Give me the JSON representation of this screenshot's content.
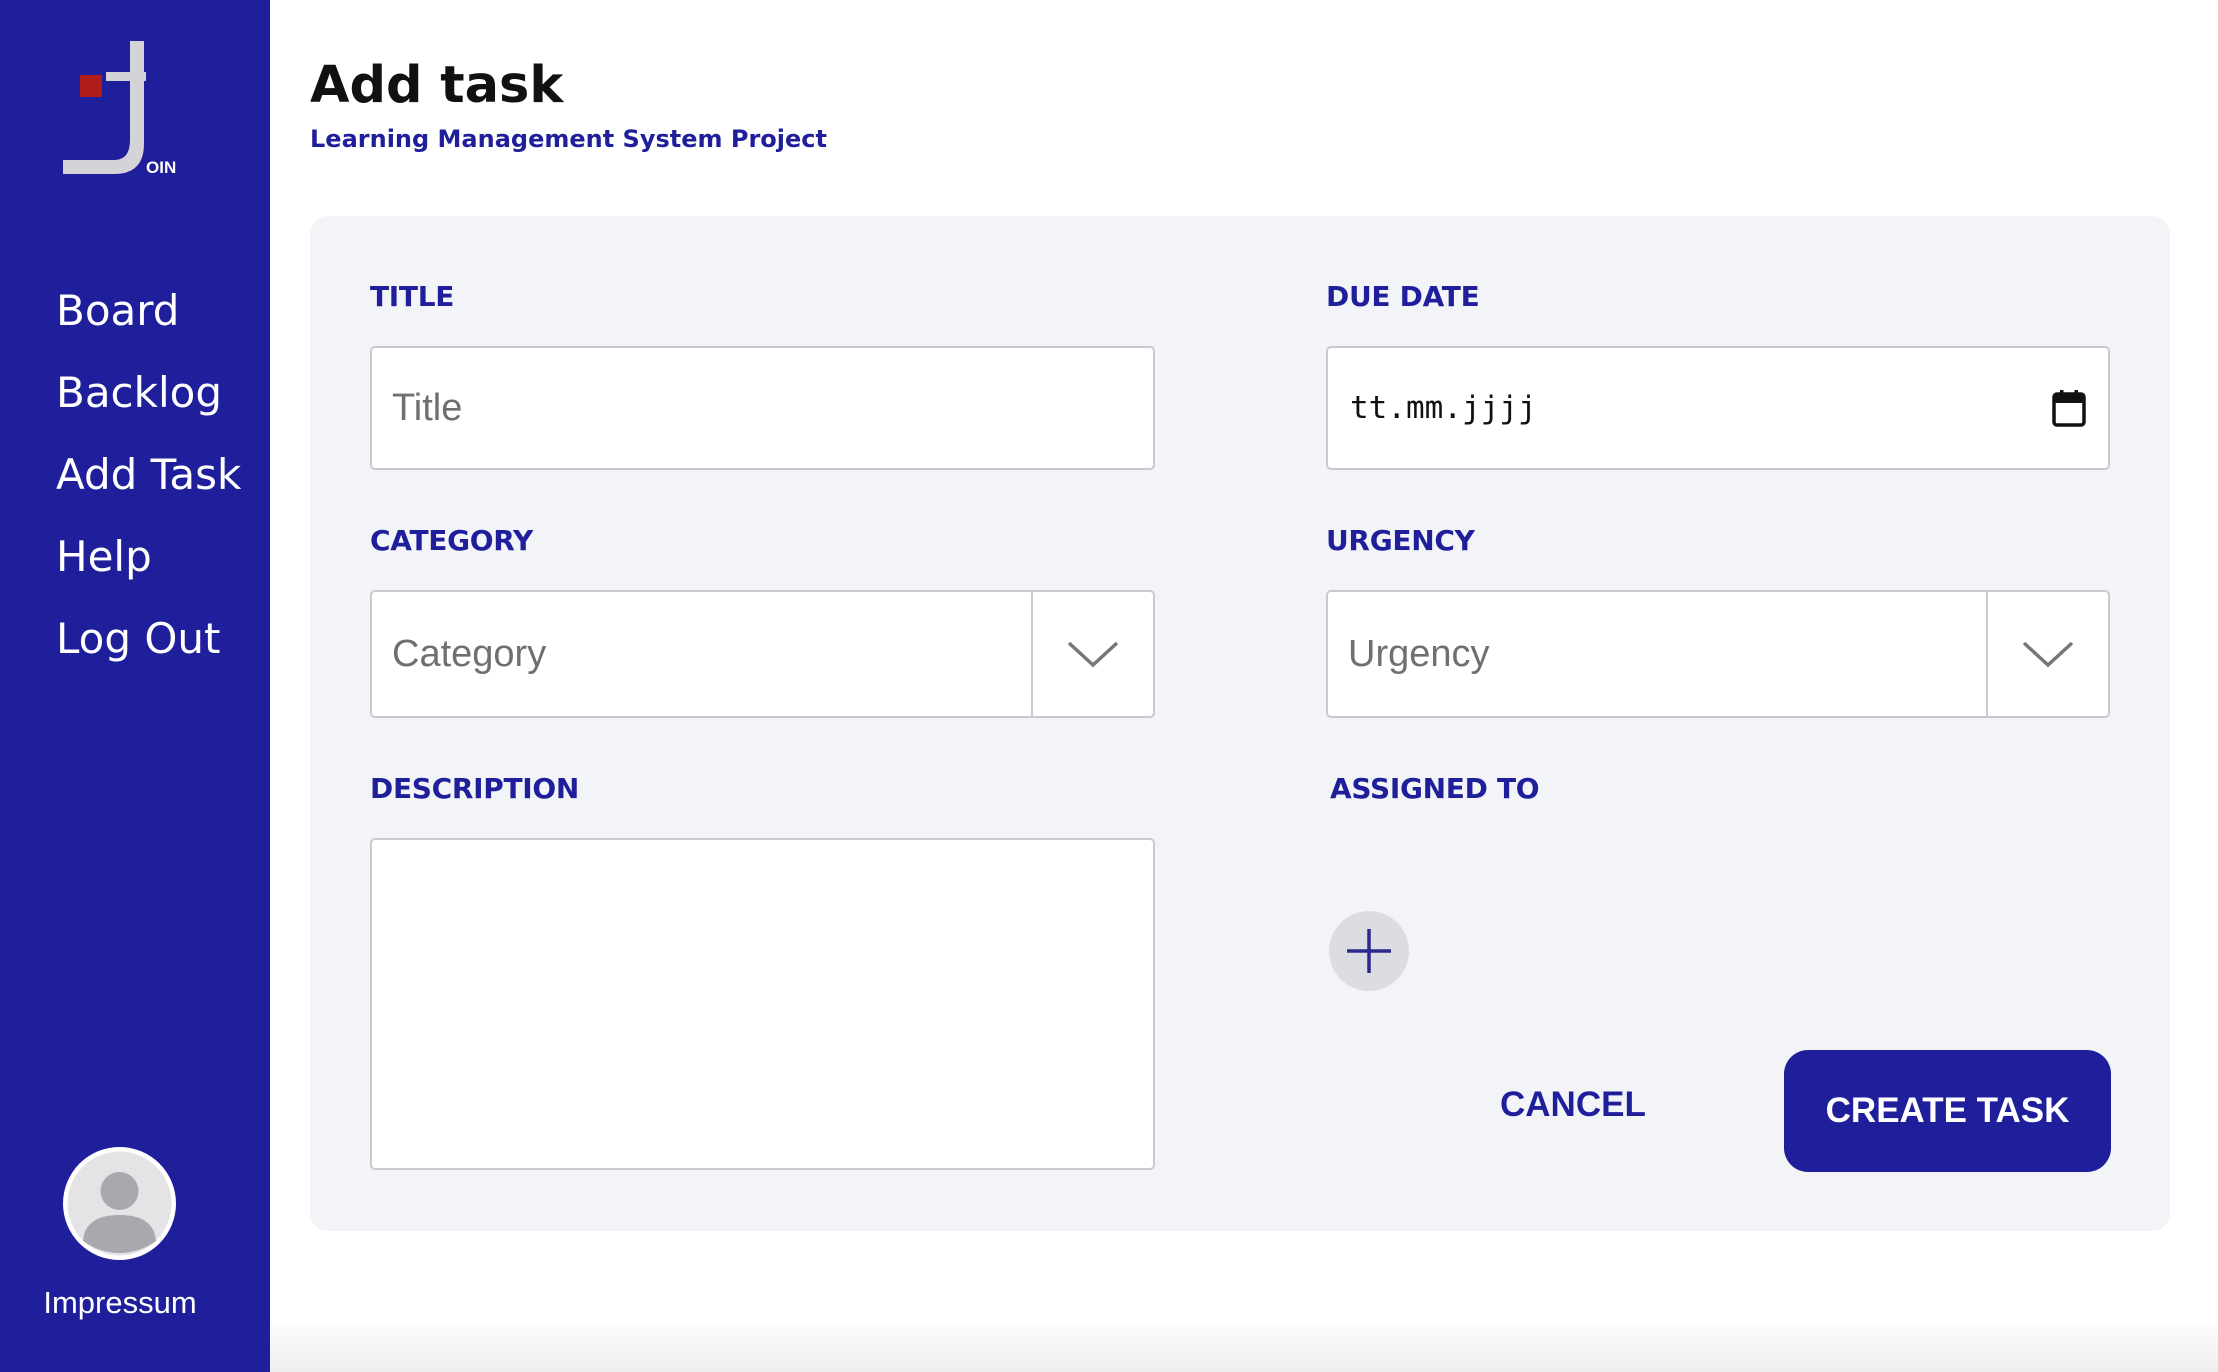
{
  "sidebar": {
    "logo_text": "OIN",
    "items": [
      {
        "label": "Board"
      },
      {
        "label": "Backlog"
      },
      {
        "label": "Add Task"
      },
      {
        "label": "Help"
      },
      {
        "label": "Log Out"
      }
    ],
    "footer_label": "Impressum",
    "avatar_icon": "user-avatar-icon"
  },
  "header": {
    "title": "Add task",
    "subtitle": "Learning Management System Project"
  },
  "form": {
    "title": {
      "label": "TITLE",
      "placeholder": "Title",
      "value": ""
    },
    "due_date": {
      "label": "DUE DATE",
      "value": "tt.mm.jjjj",
      "icon": "calendar-icon"
    },
    "category": {
      "label": "CATEGORY",
      "value": "Category",
      "icon": "chevron-down-icon"
    },
    "urgency": {
      "label": "URGENCY",
      "value": "Urgency",
      "icon": "chevron-down-icon"
    },
    "description": {
      "label": "DESCRIPTION",
      "value": ""
    },
    "assigned_to": {
      "label": "ASSIGNED TO",
      "icon": "plus-icon"
    }
  },
  "actions": {
    "cancel_label": "CANCEL",
    "create_label": "CREATE TASK"
  },
  "colors": {
    "brand": "#1f1f9c",
    "card_bg": "#f3f4f7",
    "logo_accent": "#b01c1c"
  }
}
